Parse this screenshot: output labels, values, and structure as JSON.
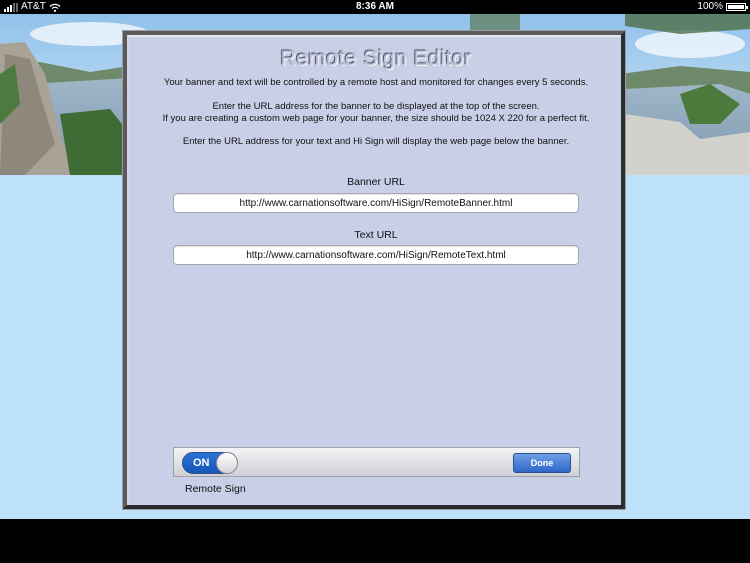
{
  "status_bar": {
    "carrier": "AT&T",
    "time": "8:36 AM",
    "battery": "100%",
    "battery_level": 1.0
  },
  "editor": {
    "title": "Remote Sign Editor",
    "intro": "Your banner and text will be controlled by a remote host and monitored for changes every 5 seconds.",
    "banner_instruction_1": "Enter the URL address for the banner to be displayed at the top of the screen.",
    "banner_instruction_2": "If you are creating a custom web page for your banner, the size should be 1024 X 220 for a perfect fit.",
    "text_instruction": "Enter the URL address for your text and Hi Sign will display the web page below the banner.",
    "banner_url_label": "Banner URL",
    "banner_url_value": "http://www.carnationsoftware.com/HiSign/RemoteBanner.html",
    "text_url_label": "Text URL",
    "text_url_value": "http://www.carnationsoftware.com/HiSign/RemoteText.html",
    "toggle_state": "ON",
    "done_label": "Done",
    "remote_sign_label": "Remote Sign"
  },
  "icons": {
    "signal": "signal-bars-icon",
    "wifi": "wifi-icon",
    "battery": "battery-icon"
  },
  "colors": {
    "panel_background": "#c8cfe6",
    "screen_background": "#bde0fb",
    "toggle_on": "#1f66cc",
    "done_button": "#3a72d0"
  }
}
